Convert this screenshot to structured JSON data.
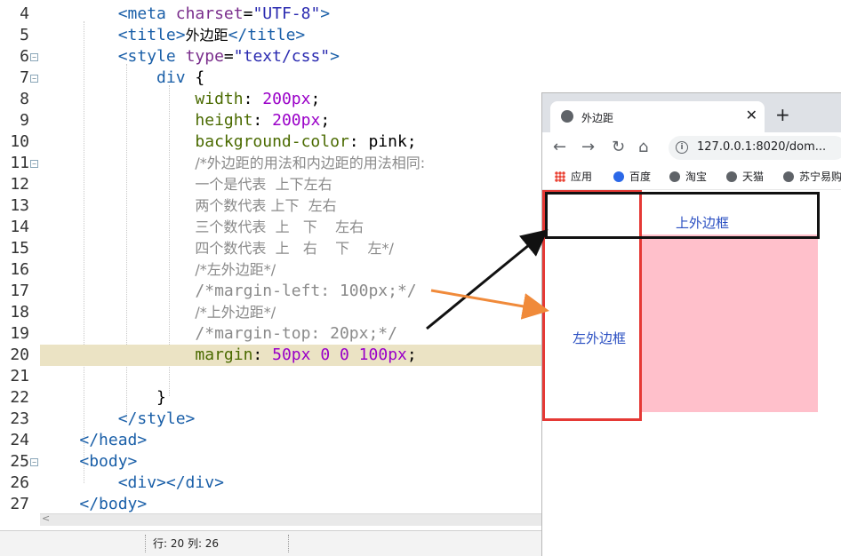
{
  "editor": {
    "lines": [
      {
        "num": "4",
        "fold": false,
        "hl": false,
        "tokens": [
          {
            "t": "        ",
            "c": ""
          },
          {
            "t": "<meta ",
            "c": "tag"
          },
          {
            "t": "charset",
            "c": "attr"
          },
          {
            "t": "=",
            "c": ""
          },
          {
            "t": "\"UTF-8\"",
            "c": "str"
          },
          {
            "t": ">",
            "c": "tag"
          }
        ]
      },
      {
        "num": "5",
        "fold": false,
        "hl": false,
        "tokens": [
          {
            "t": "        ",
            "c": ""
          },
          {
            "t": "<title>",
            "c": "tag"
          },
          {
            "t": "外边距",
            "c": "zh"
          },
          {
            "t": "</title>",
            "c": "tag"
          }
        ]
      },
      {
        "num": "6",
        "fold": true,
        "hl": false,
        "tokens": [
          {
            "t": "        ",
            "c": ""
          },
          {
            "t": "<style ",
            "c": "tag"
          },
          {
            "t": "type",
            "c": "attr"
          },
          {
            "t": "=",
            "c": ""
          },
          {
            "t": "\"text/css\"",
            "c": "str"
          },
          {
            "t": ">",
            "c": "tag"
          }
        ]
      },
      {
        "num": "7",
        "fold": true,
        "hl": false,
        "tokens": [
          {
            "t": "            ",
            "c": ""
          },
          {
            "t": "div",
            "c": "sel"
          },
          {
            "t": " {",
            "c": ""
          }
        ]
      },
      {
        "num": "8",
        "fold": false,
        "hl": false,
        "tokens": [
          {
            "t": "                ",
            "c": ""
          },
          {
            "t": "width",
            "c": "prop"
          },
          {
            "t": ": ",
            "c": ""
          },
          {
            "t": "200",
            "c": "num"
          },
          {
            "t": "px",
            "c": "num"
          },
          {
            "t": ";",
            "c": ""
          }
        ]
      },
      {
        "num": "9",
        "fold": false,
        "hl": false,
        "tokens": [
          {
            "t": "                ",
            "c": ""
          },
          {
            "t": "height",
            "c": "prop"
          },
          {
            "t": ": ",
            "c": ""
          },
          {
            "t": "200",
            "c": "num"
          },
          {
            "t": "px",
            "c": "num"
          },
          {
            "t": ";",
            "c": ""
          }
        ]
      },
      {
        "num": "10",
        "fold": false,
        "hl": false,
        "tokens": [
          {
            "t": "                ",
            "c": ""
          },
          {
            "t": "background-color",
            "c": "prop"
          },
          {
            "t": ": pink;",
            "c": ""
          }
        ]
      },
      {
        "num": "11",
        "fold": true,
        "hl": false,
        "tokens": [
          {
            "t": "                ",
            "c": ""
          },
          {
            "t": "/*外边距的用法和内边距的用法相同:",
            "c": "com zh"
          }
        ]
      },
      {
        "num": "12",
        "fold": false,
        "hl": false,
        "tokens": [
          {
            "t": "                ",
            "c": ""
          },
          {
            "t": "一个是代表  上下左右",
            "c": "com zh"
          }
        ]
      },
      {
        "num": "13",
        "fold": false,
        "hl": false,
        "tokens": [
          {
            "t": "                ",
            "c": ""
          },
          {
            "t": "两个数代表 上下  左右",
            "c": "com zh"
          }
        ]
      },
      {
        "num": "14",
        "fold": false,
        "hl": false,
        "tokens": [
          {
            "t": "                ",
            "c": ""
          },
          {
            "t": "三个数代表  上   下    左右",
            "c": "com zh"
          }
        ]
      },
      {
        "num": "15",
        "fold": false,
        "hl": false,
        "tokens": [
          {
            "t": "                ",
            "c": ""
          },
          {
            "t": "四个数代表  上   右    下    左*/",
            "c": "com zh"
          }
        ]
      },
      {
        "num": "16",
        "fold": false,
        "hl": false,
        "tokens": [
          {
            "t": "                ",
            "c": ""
          },
          {
            "t": "/*左外边距*/",
            "c": "com zh"
          }
        ]
      },
      {
        "num": "17",
        "fold": false,
        "hl": false,
        "tokens": [
          {
            "t": "                ",
            "c": ""
          },
          {
            "t": "/*margin-left: 100px;*/",
            "c": "com"
          }
        ]
      },
      {
        "num": "18",
        "fold": false,
        "hl": false,
        "tokens": [
          {
            "t": "                ",
            "c": ""
          },
          {
            "t": "/*上外边距*/",
            "c": "com zh"
          }
        ]
      },
      {
        "num": "19",
        "fold": false,
        "hl": false,
        "tokens": [
          {
            "t": "                ",
            "c": ""
          },
          {
            "t": "/*margin-top: 20px;*/",
            "c": "com"
          }
        ]
      },
      {
        "num": "20",
        "fold": false,
        "hl": true,
        "tokens": [
          {
            "t": "                ",
            "c": ""
          },
          {
            "t": "margin",
            "c": "prop"
          },
          {
            "t": ": ",
            "c": ""
          },
          {
            "t": "50",
            "c": "num"
          },
          {
            "t": "px ",
            "c": "num"
          },
          {
            "t": "0 0 ",
            "c": "num"
          },
          {
            "t": "100",
            "c": "num"
          },
          {
            "t": "px",
            "c": "num"
          },
          {
            "t": ";",
            "c": ""
          }
        ]
      },
      {
        "num": "21",
        "fold": false,
        "hl": false,
        "tokens": []
      },
      {
        "num": "22",
        "fold": false,
        "hl": false,
        "tokens": [
          {
            "t": "            ",
            "c": ""
          },
          {
            "t": "}",
            "c": ""
          }
        ]
      },
      {
        "num": "23",
        "fold": false,
        "hl": false,
        "tokens": [
          {
            "t": "        ",
            "c": ""
          },
          {
            "t": "</style>",
            "c": "tag"
          }
        ]
      },
      {
        "num": "24",
        "fold": false,
        "hl": false,
        "tokens": [
          {
            "t": "    ",
            "c": ""
          },
          {
            "t": "</head>",
            "c": "tag"
          }
        ]
      },
      {
        "num": "25",
        "fold": true,
        "hl": false,
        "tokens": [
          {
            "t": "    ",
            "c": ""
          },
          {
            "t": "<body>",
            "c": "tag"
          }
        ]
      },
      {
        "num": "26",
        "fold": false,
        "hl": false,
        "tokens": [
          {
            "t": "        ",
            "c": ""
          },
          {
            "t": "<div></div>",
            "c": "tag"
          }
        ]
      },
      {
        "num": "27",
        "fold": false,
        "hl": false,
        "tokens": [
          {
            "t": "    ",
            "c": ""
          },
          {
            "t": "</body>",
            "c": "tag"
          }
        ]
      }
    ],
    "fold_glyph": "−"
  },
  "statusbar": {
    "position": "行: 20 列: 26"
  },
  "browser": {
    "tab_title": "外边距",
    "tab_close": "✕",
    "new_tab": "+",
    "back": "←",
    "forward": "→",
    "reload": "↻",
    "home": "⌂",
    "info": "i",
    "url": "127.0.0.1:8020/dom...",
    "bookmarks": [
      "应用",
      "百度",
      "淘宝",
      "天猫",
      "苏宁易购"
    ],
    "top_label": "上外边框",
    "left_label": "左外边框"
  },
  "colors": {
    "pink": "#ffc0cb",
    "red_frame": "#e53935",
    "arrow_orange": "#f08a3a"
  }
}
